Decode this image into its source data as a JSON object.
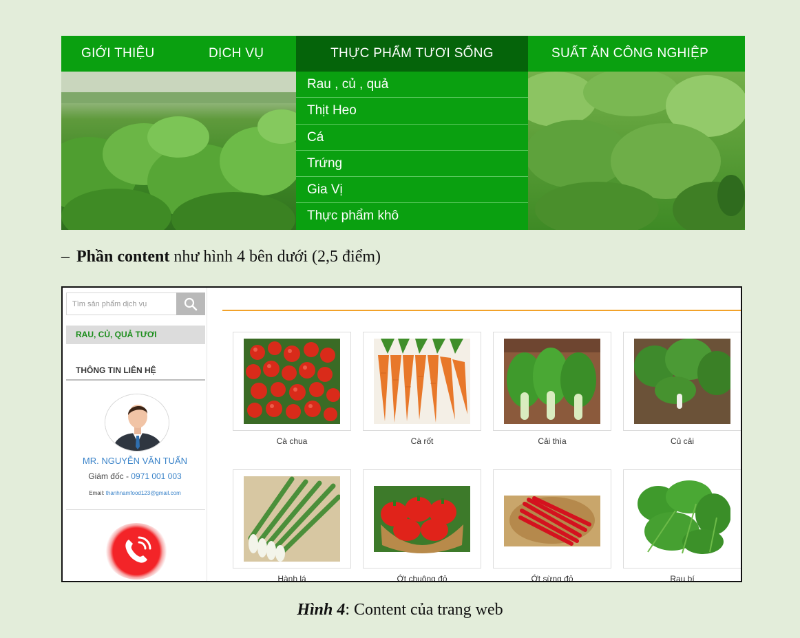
{
  "banner": {
    "nav": [
      "GIỚI THIỆU",
      "DỊCH VỤ",
      "THỰC PHẨM TƯƠI SỐNG",
      "SUẤT ĂN CÔNG NGHIỆP"
    ],
    "dropdown": [
      "Rau , củ , quả",
      "Thịt Heo",
      "Cá",
      "Trứng",
      "Gia Vị",
      "Thực phẩm khô"
    ]
  },
  "instruction": {
    "dash": "–",
    "bold": "Phần content",
    "rest": " như hình 4 bên dưới (2,5 điểm)"
  },
  "content": {
    "search": {
      "placeholder": "Tìm sản phẩm dịch vụ",
      "icon": "search-icon"
    },
    "category": "RAU, CỦ, QUẢ TƯƠI",
    "contact_title": "THÔNG TIN LIÊN HỆ",
    "contact": {
      "name": "MR. NGUYỄN VĂN TUẤN",
      "role": "Giám đốc - ",
      "phone": "0971 001 003",
      "email_label": "Email: ",
      "email": "thanhnamfood123@gmail.com"
    },
    "products": [
      "Cà chua",
      "Cà rốt",
      "Cải thìa",
      "Củ cải",
      "Hành lá",
      "Ớt chuông đỏ",
      "Ớt sừng đỏ",
      "Rau bí"
    ]
  },
  "caption": {
    "figure": "Hình 4",
    "text": ": Content của trang web"
  },
  "colors": {
    "nav_green": "#0aa010",
    "nav_active": "#05640a",
    "accent_orange": "#f2a22a",
    "link_blue": "#3a83c9",
    "call_red": "#f32428",
    "page_bg": "#e3edda"
  }
}
